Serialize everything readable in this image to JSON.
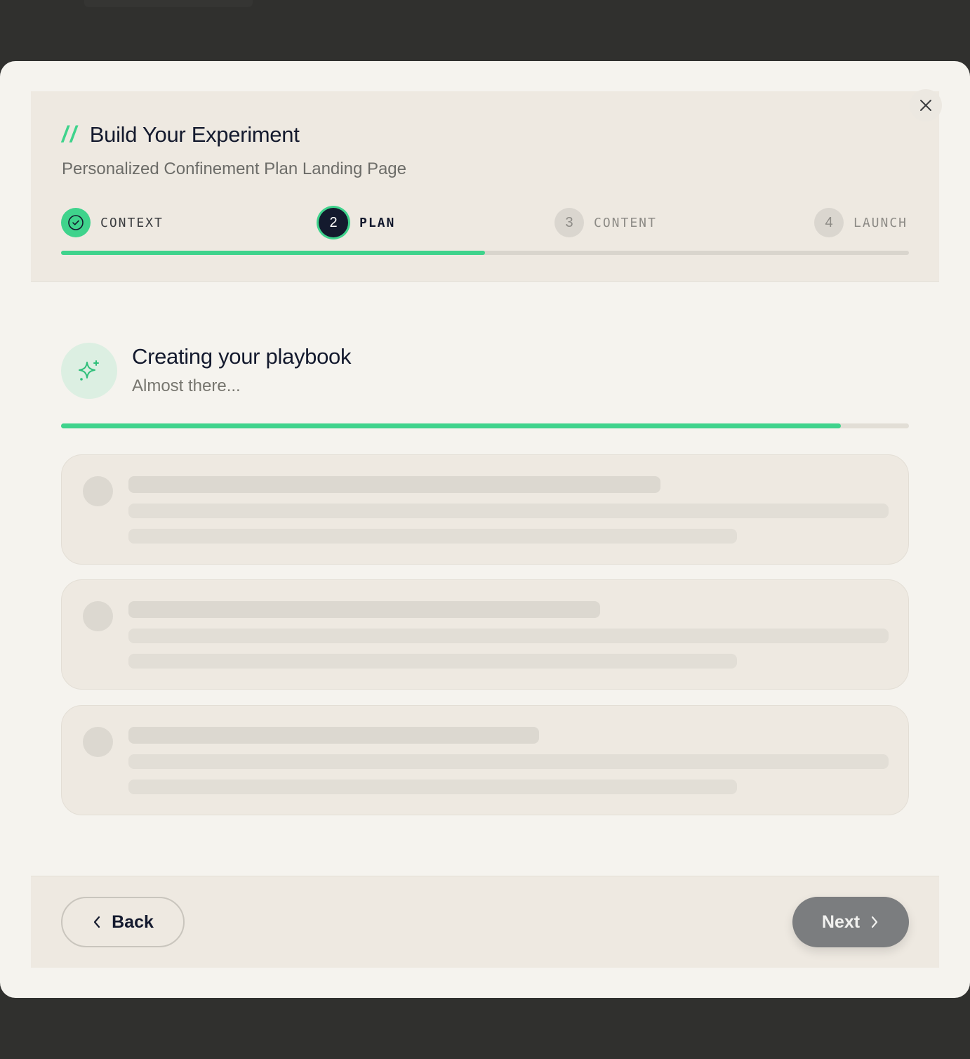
{
  "modal": {
    "title_prefix": "//",
    "title": "Build Your Experiment",
    "subtitle": "Personalized Confinement Plan Landing Page"
  },
  "steps": [
    {
      "number": "",
      "label": "CONTEXT",
      "state": "complete",
      "icon": "check-icon"
    },
    {
      "number": "2",
      "label": "PLAN",
      "state": "active"
    },
    {
      "number": "3",
      "label": "CONTENT",
      "state": "upcoming"
    },
    {
      "number": "4",
      "label": "LAUNCH",
      "state": "upcoming"
    }
  ],
  "step_progress": 0.5,
  "loading": {
    "icon": "sparkles-icon",
    "title": "Creating your playbook",
    "subtitle": "Almost there...",
    "progress": 0.92
  },
  "footer": {
    "back_label": "Back",
    "next_label": "Next"
  },
  "colors": {
    "accent": "#3fd38c",
    "navy": "#141a2e",
    "background": "#f5f3ee",
    "panel": "#eee9e1",
    "next_button": "#7b7d7f"
  }
}
